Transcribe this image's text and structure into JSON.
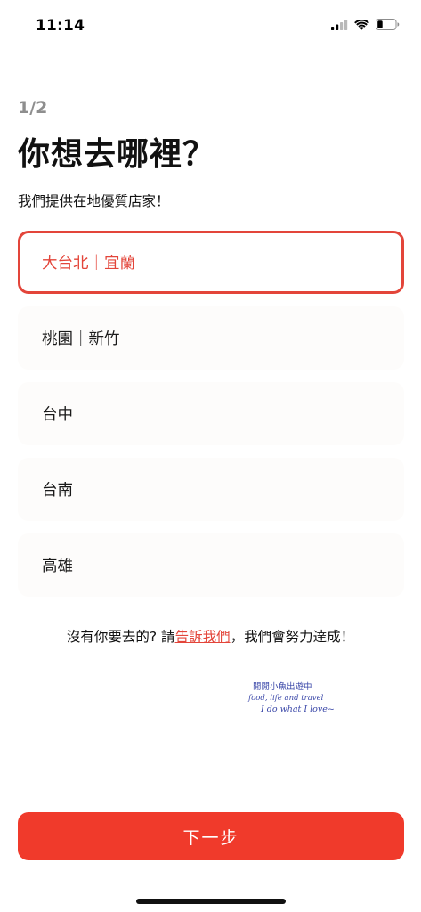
{
  "status_bar": {
    "time": "11:14",
    "icons": [
      "cellular-signal-icon",
      "wifi-icon",
      "battery-icon"
    ]
  },
  "header": {
    "step": "1/2",
    "title": "你想去哪裡？",
    "subtitle": "我們提供在地優質店家！"
  },
  "options": [
    {
      "label": "大台北｜宜蘭",
      "selected": true
    },
    {
      "label": "桃園｜新竹",
      "selected": false
    },
    {
      "label": "台中",
      "selected": false
    },
    {
      "label": "台南",
      "selected": false
    },
    {
      "label": "高雄",
      "selected": false
    }
  ],
  "helper": {
    "prefix": "沒有你要去的? 請",
    "link": "告訴我們",
    "suffix": "，我們會努力達成！"
  },
  "watermark": {
    "line1": "閒閒小魚出遊中",
    "line2": "food, life and travel",
    "line3": "I do what I love~"
  },
  "footer": {
    "next_label": "下一步"
  },
  "colors": {
    "accent": "#e3453a",
    "button": "#f03a2b",
    "option_bg": "#fdfcfb",
    "step_gray": "#8e8e8e",
    "watermark_blue": "#3a47a8"
  }
}
